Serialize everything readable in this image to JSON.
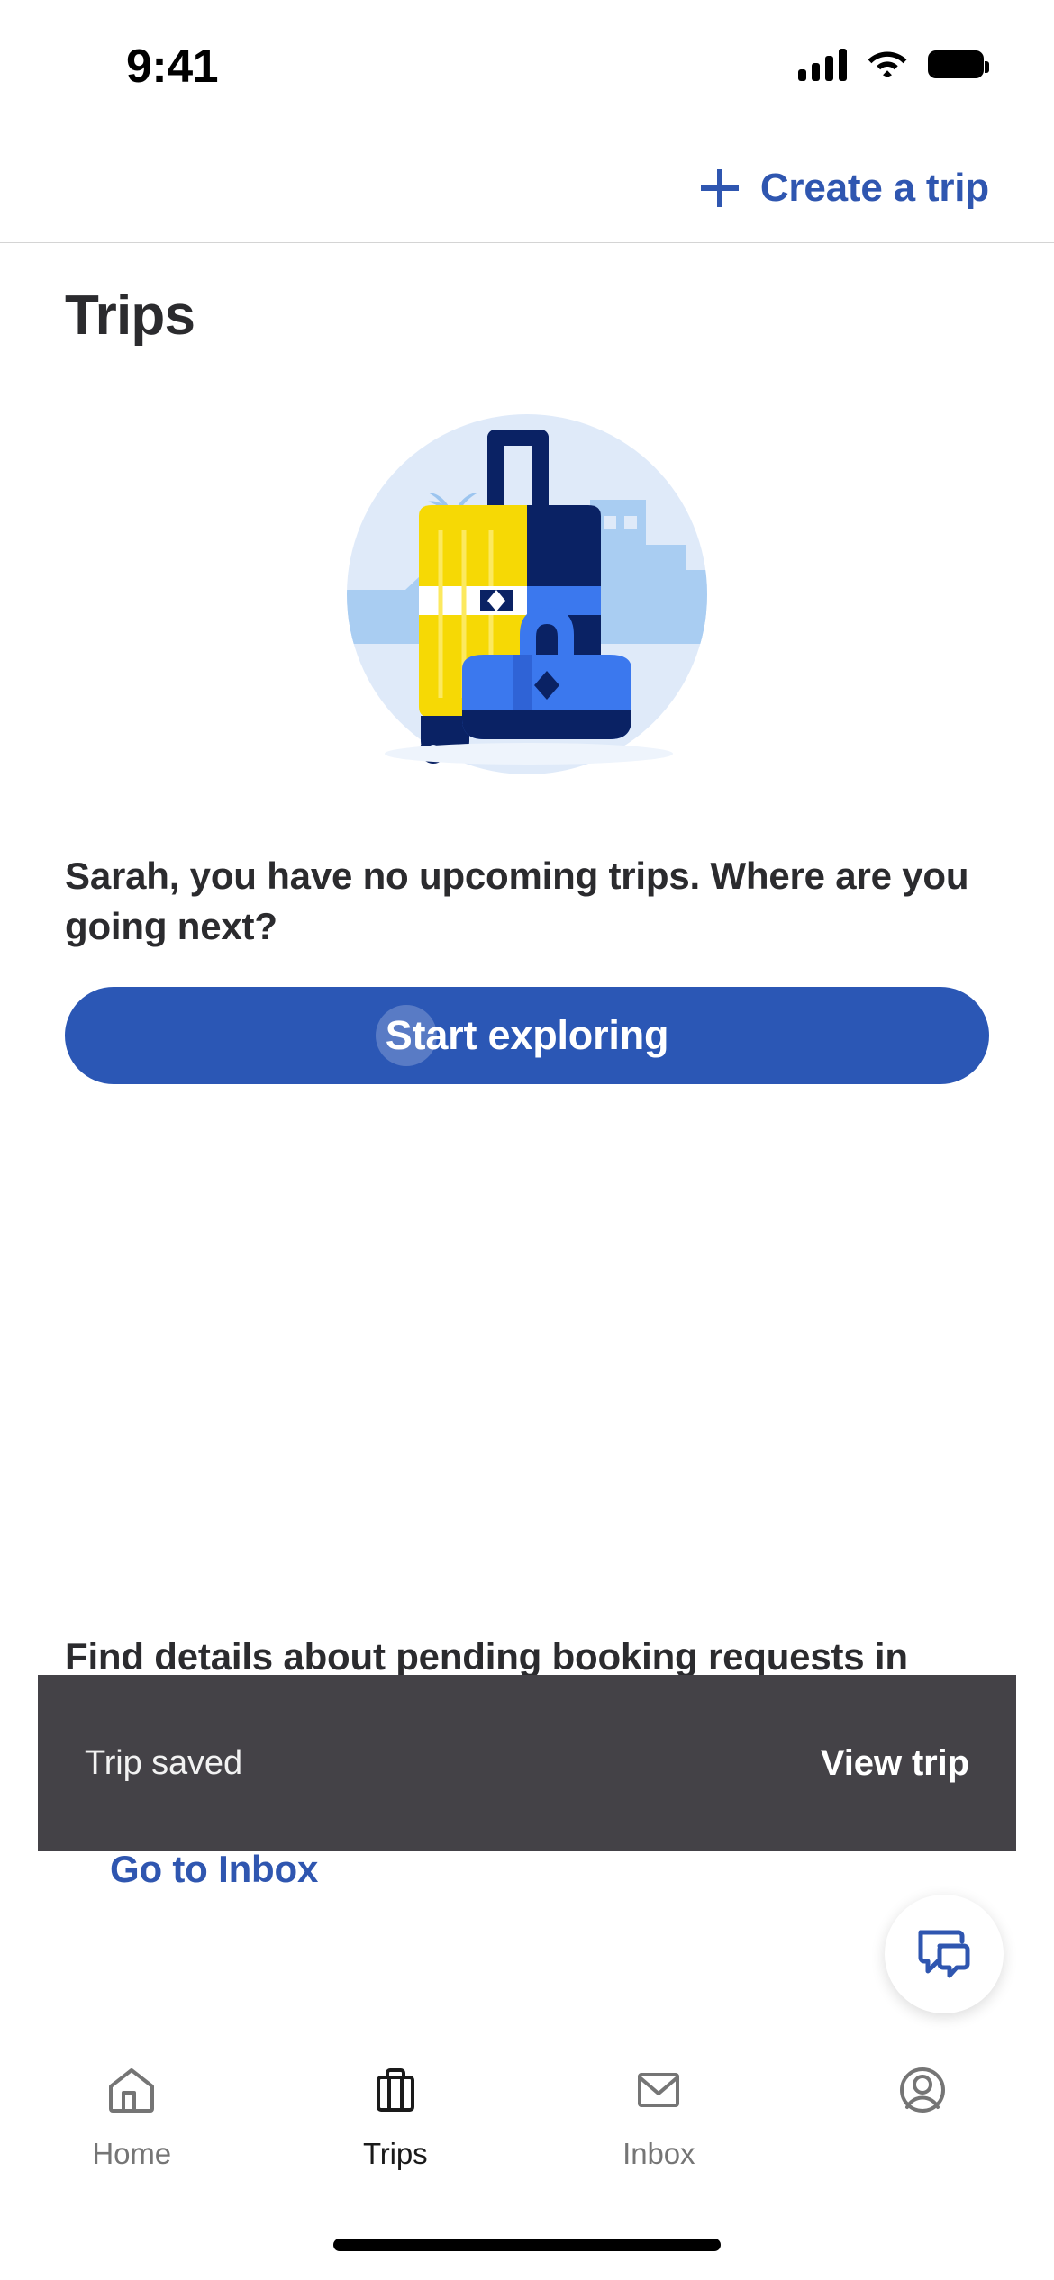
{
  "status_bar": {
    "time": "9:41",
    "cellular_icon": "cellular-signal-icon",
    "wifi_icon": "wifi-icon",
    "battery_icon": "battery-full-icon"
  },
  "header": {
    "create_trip_label": "Create a trip",
    "plus_icon": "plus-icon",
    "accent_color": "#2f56b0"
  },
  "page": {
    "title": "Trips"
  },
  "illustration": {
    "name": "luggage-illustration",
    "circle_bg_color": "#dfeaf9",
    "skyline_color": "#a9cdf2",
    "suitcase_yellow": "#f6d905",
    "suitcase_navy": "#0a2264",
    "duffel_blue": "#3b78ee"
  },
  "empty_state": {
    "message": "Sarah, you have no upcoming trips. Where are you going next?",
    "cta_label": "Start exploring",
    "cta_color": "#2b57b5"
  },
  "pending_section": {
    "message": "Find details about pending booking requests in",
    "link_label": "Go to Inbox"
  },
  "snackbar": {
    "message": "Trip saved",
    "action_label": "View trip",
    "background_color": "#444247"
  },
  "chat_fab": {
    "icon": "chat-bubbles-icon",
    "color": "#2f56b0"
  },
  "bottom_nav": {
    "items": [
      {
        "label": "Home",
        "icon": "home-icon",
        "active": false
      },
      {
        "label": "Trips",
        "icon": "suitcase-icon",
        "active": true
      },
      {
        "label": "Inbox",
        "icon": "envelope-icon",
        "active": false
      },
      {
        "label": "",
        "icon": "account-circle-icon",
        "active": false
      }
    ]
  }
}
